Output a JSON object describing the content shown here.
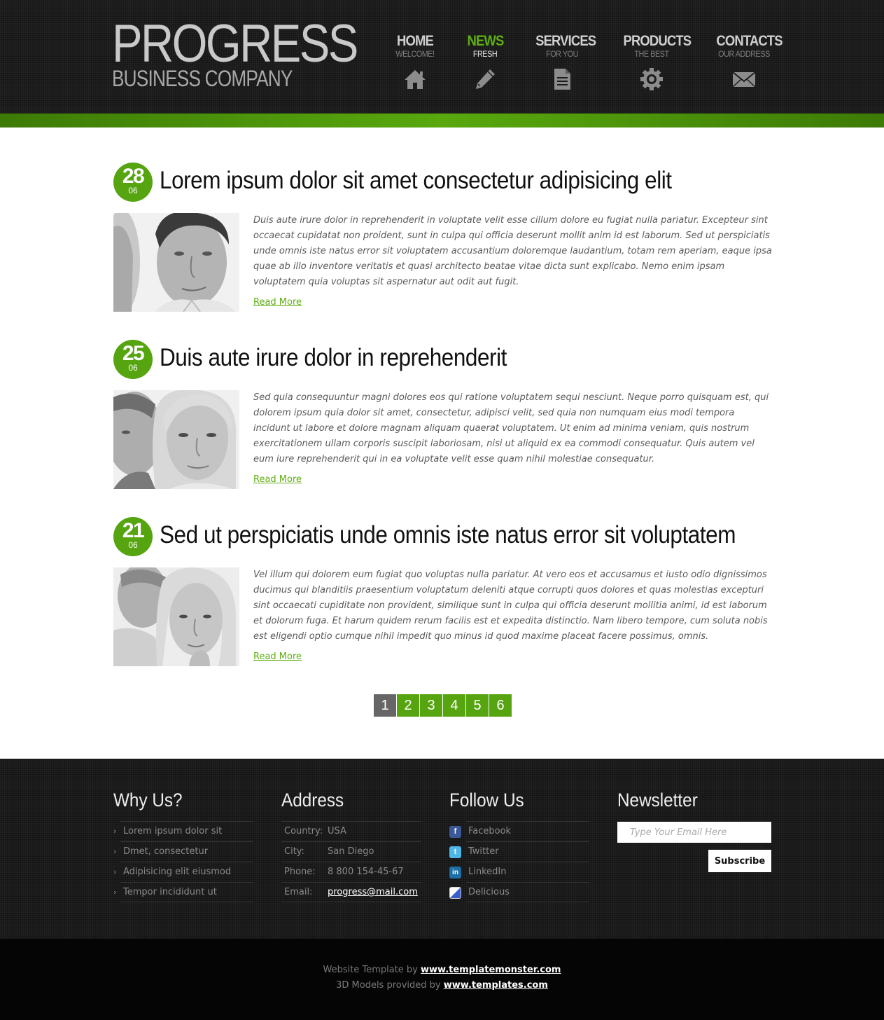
{
  "brand": {
    "title": "PROGRESS",
    "subtitle": "BUSINESS COMPANY"
  },
  "nav": [
    {
      "label": "HOME",
      "sub": "WELCOME!",
      "icon": "home-icon",
      "active": false
    },
    {
      "label": "NEWS",
      "sub": "FRESH",
      "icon": "pencil-icon",
      "active": true
    },
    {
      "label": "SERVICES",
      "sub": "FOR YOU",
      "icon": "document-icon",
      "active": false
    },
    {
      "label": "PRODUCTS",
      "sub": "THE BEST",
      "icon": "gear-icon",
      "active": false
    },
    {
      "label": "CONTACTS",
      "sub": "OUR ADDRESS",
      "icon": "envelope-icon",
      "active": false
    }
  ],
  "posts": [
    {
      "day": "28",
      "month": "06",
      "title": "Lorem ipsum dolor sit amet consectetur adipisicing elit",
      "text": "Duis aute irure dolor in reprehenderit in voluptate velit esse cillum dolore eu fugiat nulla pariatur. Excepteur sint occaecat cupidatat non proident, sunt in culpa qui officia deserunt mollit anim id est laborum. Sed ut perspiciatis unde omnis iste natus error sit voluptatem accusantium doloremque laudantium, totam rem aperiam, eaque ipsa quae ab illo inventore veritatis et quasi architecto beatae vitae dicta sunt explicabo. Nemo enim ipsam voluptatem quia voluptas sit aspernatur aut odit aut fugit.",
      "read_more": "Read More"
    },
    {
      "day": "25",
      "month": "06",
      "title": "Duis aute irure dolor in reprehenderit",
      "text": "Sed quia consequuntur magni dolores eos qui ratione voluptatem sequi nesciunt. Neque porro quisquam est, qui dolorem ipsum quia dolor sit amet, consectetur, adipisci velit, sed quia non numquam eius modi tempora incidunt ut labore et dolore magnam aliquam quaerat voluptatem. Ut enim ad minima veniam, quis nostrum exercitationem ullam corporis suscipit laboriosam, nisi ut aliquid ex ea commodi consequatur. Quis autem vel eum iure reprehenderit qui in ea voluptate velit esse quam nihil molestiae consequatur.",
      "read_more": "Read More"
    },
    {
      "day": "21",
      "month": "06",
      "title": "Sed ut perspiciatis unde omnis iste natus error sit voluptatem",
      "text": "Vel illum qui dolorem eum fugiat quo voluptas nulla pariatur. At vero eos et accusamus et iusto odio dignissimos ducimus qui blanditiis praesentium voluptatum deleniti atque corrupti quos dolores et quas molestias excepturi sint occaecati cupiditate non provident, similique sunt in culpa qui officia deserunt mollitia animi, id est laborum et dolorum fuga. Et harum quidem rerum facilis est et expedita distinctio. Nam libero tempore, cum soluta nobis est eligendi optio cumque nihil impedit quo minus id quod maxime placeat facere possimus, omnis.",
      "read_more": "Read More"
    }
  ],
  "pagination": {
    "pages": [
      "1",
      "2",
      "3",
      "4",
      "5",
      "6"
    ],
    "current": "1"
  },
  "footer": {
    "why": {
      "title": "Why Us?",
      "items": [
        "Lorem ipsum dolor sit",
        "Dmet, consectetur",
        "Adipisicing elit eiusmod",
        "Tempor incididunt ut"
      ]
    },
    "address": {
      "title": "Address",
      "rows": [
        {
          "key": "Country:",
          "value": "USA"
        },
        {
          "key": "City:",
          "value": "San Diego"
        },
        {
          "key": "Phone:",
          "value": "8 800 154-45-67"
        },
        {
          "key": "Email:",
          "value": "progress@mail.com"
        }
      ]
    },
    "follow": {
      "title": "Follow Us",
      "items": [
        {
          "label": "Facebook",
          "icon": "facebook-icon",
          "color": "#3b5998"
        },
        {
          "label": "Twitter",
          "icon": "twitter-icon",
          "color": "#4fb6e8"
        },
        {
          "label": "LinkedIn",
          "icon": "linkedin-icon",
          "color": "#1c6fa8"
        },
        {
          "label": "Delicious",
          "icon": "delicious-icon",
          "color": "#3a5fcd"
        }
      ]
    },
    "newsletter": {
      "title": "Newsletter",
      "placeholder": "Type Your Email Here",
      "button": "Subscribe"
    }
  },
  "credits": {
    "line1_prefix": "Website Template by",
    "line1_link": "www.templatemonster.com",
    "line2_prefix": "3D Models provided by",
    "line2_link": "www.templates.com"
  },
  "colors": {
    "accent": "#55a410",
    "header_bg": "#1c1c1c",
    "footer_bg": "#1b1b1b"
  }
}
